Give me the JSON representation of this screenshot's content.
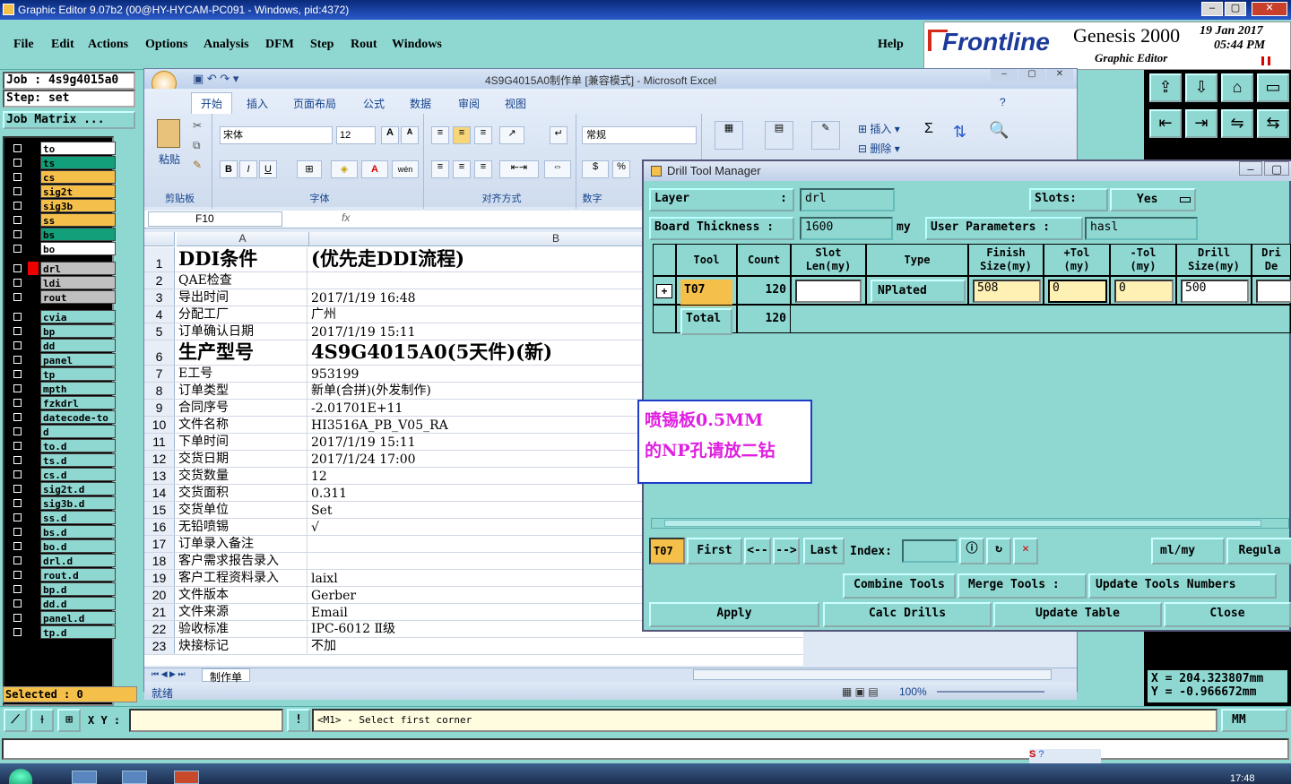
{
  "app": {
    "title": "Graphic Editor 9.07b2 (00@HY-HYCAM-PC091 - Windows, pid:4372)",
    "menus": [
      "File",
      "Edit",
      "Actions",
      "Options",
      "Analysis",
      "DFM",
      "Step",
      "Rout",
      "Windows"
    ],
    "help": "Help",
    "brand": {
      "logo": "Frontline",
      "product": "Genesis 2000",
      "sub": "Graphic Editor",
      "date": "19 Jan 2017",
      "time": "05:44 PM"
    }
  },
  "left": {
    "job": "Job : 4s9g4015a0",
    "step": "Step: set",
    "job_matrix": "Job Matrix ...",
    "layers": [
      {
        "name": "to",
        "color": "#ffffff"
      },
      {
        "name": "ts",
        "color": "#11a079"
      },
      {
        "name": "cs",
        "color": "#f5c04a"
      },
      {
        "name": "sig2t",
        "color": "#f5c04a"
      },
      {
        "name": "sig3b",
        "color": "#f5c04a"
      },
      {
        "name": "ss",
        "color": "#f5c04a"
      },
      {
        "name": "bs",
        "color": "#11a079"
      },
      {
        "name": "bo",
        "color": "#ffffff"
      },
      {
        "name": "drl",
        "color": "#c0c0c0",
        "active": true
      },
      {
        "name": "ldi",
        "color": "#c0c0c0"
      },
      {
        "name": "rout",
        "color": "#c0c0c0"
      },
      {
        "name": "cvia",
        "color": "#8fd8d2"
      },
      {
        "name": "bp",
        "color": "#8fd8d2"
      },
      {
        "name": "dd",
        "color": "#8fd8d2"
      },
      {
        "name": "panel",
        "color": "#8fd8d2"
      },
      {
        "name": "tp",
        "color": "#8fd8d2"
      },
      {
        "name": "mpth",
        "color": "#8fd8d2"
      },
      {
        "name": "fzkdrl",
        "color": "#8fd8d2"
      },
      {
        "name": "datecode-to",
        "color": "#8fd8d2"
      },
      {
        "name": "d",
        "color": "#8fd8d2"
      },
      {
        "name": "to.d",
        "color": "#8fd8d2"
      },
      {
        "name": "ts.d",
        "color": "#8fd8d2"
      },
      {
        "name": "cs.d",
        "color": "#8fd8d2"
      },
      {
        "name": "sig2t.d",
        "color": "#8fd8d2"
      },
      {
        "name": "sig3b.d",
        "color": "#8fd8d2"
      },
      {
        "name": "ss.d",
        "color": "#8fd8d2"
      },
      {
        "name": "bs.d",
        "color": "#8fd8d2"
      },
      {
        "name": "bo.d",
        "color": "#8fd8d2"
      },
      {
        "name": "drl.d",
        "color": "#8fd8d2"
      },
      {
        "name": "rout.d",
        "color": "#8fd8d2"
      },
      {
        "name": "bp.d",
        "color": "#8fd8d2"
      },
      {
        "name": "dd.d",
        "color": "#8fd8d2"
      },
      {
        "name": "panel.d",
        "color": "#8fd8d2"
      },
      {
        "name": "tp.d",
        "color": "#8fd8d2"
      }
    ],
    "selected": "Selected : 0"
  },
  "excel": {
    "title": "4S9G4015A0制作单 [兼容模式] - Microsoft Excel",
    "tabs": [
      "开始",
      "插入",
      "页面布局",
      "公式",
      "数据",
      "审阅",
      "视图"
    ],
    "paste": "粘贴",
    "clipboard": "剪贴板",
    "font_name": "宋体",
    "font_size": "12",
    "font_group": "字体",
    "align_group": "对齐方式",
    "number_format": "常规",
    "number_group": "数字",
    "insert": "插入",
    "delete": "删除",
    "name_box": "F10",
    "fx": "fx",
    "col_a": "A",
    "col_b": "B",
    "rows": [
      {
        "n": "1",
        "a": "DDI条件",
        "b": "(优先走DDI流程)",
        "big": true
      },
      {
        "n": "2",
        "a": "QAE检查",
        "b": ""
      },
      {
        "n": "3",
        "a": "导出时间",
        "b": "2017/1/19 16:48"
      },
      {
        "n": "4",
        "a": "分配工厂",
        "b": "广州"
      },
      {
        "n": "5",
        "a": "订单确认日期",
        "b": "2017/1/19 15:11"
      },
      {
        "n": "6",
        "a": " 生产型号",
        "b": "4S9G4015A0(5天件)(新)",
        "big": true
      },
      {
        "n": "7",
        "a": "E工号",
        "b": "953199"
      },
      {
        "n": "8",
        "a": "订单类型",
        "b": "新单(合拼)(外发制作)"
      },
      {
        "n": "9",
        "a": "合同序号",
        "b": "-2.01701E+11"
      },
      {
        "n": "10",
        "a": "文件名称",
        "b": "HI3516A_PB_V05_RA"
      },
      {
        "n": "11",
        "a": "下单时间",
        "b": "2017/1/19 15:11"
      },
      {
        "n": "12",
        "a": "交货日期",
        "b": "2017/1/24 17:00"
      },
      {
        "n": "13",
        "a": "交货数量",
        "b": "12"
      },
      {
        "n": "14",
        "a": "交货面积",
        "b": "0.311"
      },
      {
        "n": "15",
        "a": "交货单位",
        "b": "Set"
      },
      {
        "n": "16",
        "a": "无铅喷锡",
        "b": "√"
      },
      {
        "n": "17",
        "a": "订单录入备注",
        "b": ""
      },
      {
        "n": "18",
        "a": "客户需求报告录入",
        "b": ""
      },
      {
        "n": "19",
        "a": "客户工程资料录入",
        "b": "laixl"
      },
      {
        "n": "20",
        "a": "文件版本",
        "b": "Gerber"
      },
      {
        "n": "21",
        "a": "文件来源",
        "b": "Email"
      },
      {
        "n": "22",
        "a": "验收标准",
        "b": "IPC-6012 Ⅱ级"
      },
      {
        "n": "23",
        "a": "炔接标记",
        "b": "不加"
      }
    ],
    "sheet_tab": "制作单",
    "status": "就绪",
    "zoom": "100%"
  },
  "drill": {
    "title": "Drill Tool Manager",
    "layer_label": "Layer",
    "layer_value": "drl",
    "slots_label": "Slots:",
    "slots_value": "Yes",
    "thickness_label": "Board Thickness :",
    "thickness_value": "1600",
    "thickness_unit": "my",
    "user_params_label": "User Parameters :",
    "user_params_value": "hasl",
    "headers": [
      "Tool",
      "Count",
      "Slot\nLen(my)",
      "Type",
      "Finish\nSize(my)",
      "+Tol\n(my)",
      "-Tol\n(my)",
      "Drill\nSize(my)",
      "Dri\nDe"
    ],
    "row": {
      "tool": "T07",
      "count": "120",
      "slot_len": "",
      "type": "NPlated",
      "finish": "508",
      "ptol": "0",
      "ntol": "0",
      "drill": "500"
    },
    "total_label": "Total",
    "total_count": "120",
    "nav_tool": "T07",
    "first": "First",
    "prev": "<--",
    "next": "-->",
    "last": "Last",
    "index_label": "Index:",
    "units": "ml/my",
    "regular": "Regula",
    "combine": "Combine Tools",
    "merge": "Merge Tools :",
    "update_numbers": "Update Tools Numbers",
    "apply": "Apply",
    "calc": "Calc Drills",
    "update_table": "Update Table",
    "close": "Close"
  },
  "note": {
    "line1": "喷锡板0.5MM",
    "line2": "的NP孔请放二钻"
  },
  "coords": {
    "x": "X = 204.323807mm",
    "y": "Y = -0.966672mm"
  },
  "bottom": {
    "xy_label": "X Y :",
    "prompt": "<M1> - Select first corner",
    "units": "MM"
  },
  "taskbar": {
    "time": "17:48"
  }
}
